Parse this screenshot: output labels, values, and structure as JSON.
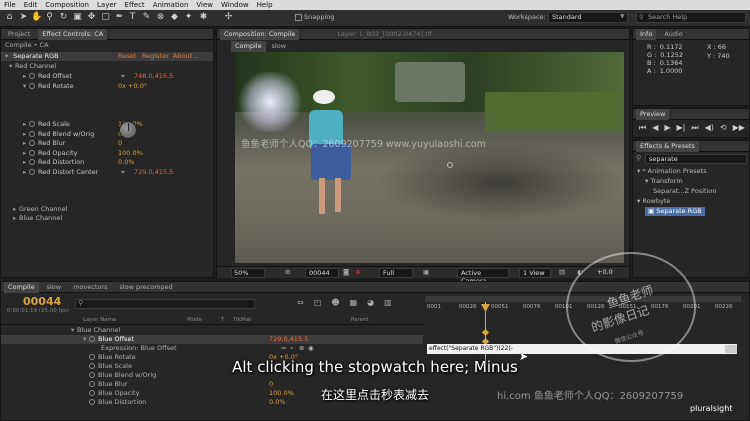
{
  "menu": [
    "File",
    "Edit",
    "Composition",
    "Layer",
    "Effect",
    "Animation",
    "View",
    "Window",
    "Help"
  ],
  "toolbar": {
    "snapping_label": "Snapping",
    "workspace_label": "Workspace:",
    "workspace_value": "Standard",
    "search_placeholder": "Search Help"
  },
  "effect_controls": {
    "tabs": [
      "Project",
      "Effect Controls: CA"
    ],
    "breadcrumb": "Compile • CA",
    "effect_name": "Separate RGB",
    "effect_links": [
      "Reset",
      "Register",
      "About..."
    ],
    "red_channel": "Red Channel",
    "props": [
      {
        "label": "Red Offset",
        "value": "748.0,416.5",
        "depth": 2,
        "kind": "point"
      },
      {
        "label": "Red Rotate",
        "value": "0x +0.0°",
        "depth": 2,
        "kind": "plain"
      },
      {
        "label": "Red Scale",
        "value": "100.0%",
        "depth": 2,
        "kind": "plain"
      },
      {
        "label": "Red Blend w/Orig",
        "value": "0.0%",
        "depth": 2,
        "kind": "plain"
      },
      {
        "label": "Red Blur",
        "value": "0",
        "depth": 2,
        "kind": "plain"
      },
      {
        "label": "Red Opacity",
        "value": "100.0%",
        "depth": 2,
        "kind": "plain"
      },
      {
        "label": "Red Distortion",
        "value": "0.0%",
        "depth": 2,
        "kind": "plain"
      },
      {
        "label": "Red Distort Center",
        "value": "729.0,415.5",
        "depth": 2,
        "kind": "point"
      }
    ],
    "green_channel": "Green Channel",
    "blue_channel": "Blue Channel"
  },
  "composition": {
    "tab": "Composition: Compile",
    "layer_tab": "Layer: L_B02_[0002-0474].tif",
    "breadcrumbs": [
      "Compile",
      "slow"
    ],
    "zoom": "50%",
    "timecode": "00044",
    "resolution": "Full",
    "camera": "Active Camera",
    "view": "1 View",
    "offset": "+0.0"
  },
  "info": {
    "tabs": [
      "Info",
      "Audio"
    ],
    "rows": [
      {
        "k": "R :",
        "v": "0.1172"
      },
      {
        "k": "G :",
        "v": "0.1252"
      },
      {
        "k": "B :",
        "v": "0.1364"
      },
      {
        "k": "A :",
        "v": "1.0000"
      }
    ],
    "x": "X : 66",
    "y": "Y : 740"
  },
  "preview": {
    "tab": "Preview"
  },
  "effects_presets": {
    "tab": "Effects & Presets",
    "search": "separate",
    "items": [
      {
        "label": "* Animation Presets",
        "depth": 0
      },
      {
        "label": "Transform",
        "depth": 1
      },
      {
        "label": "Separat...Z Position",
        "depth": 2
      },
      {
        "label": "Rowbyte",
        "depth": 0
      },
      {
        "label": "Separate RGB",
        "depth": 1
      }
    ]
  },
  "timeline": {
    "tabs": [
      "Compile",
      "slow",
      "movectors",
      "slow precomped"
    ],
    "timecode": "00044",
    "timecode_sub": "0:00:01:19 (25.00 fps)",
    "columns": {
      "layer_name": "Layer Name",
      "mode": "Mode",
      "t": "T",
      "trkmat": "TrkMat",
      "parent": "Parent"
    },
    "ruler": [
      "0001",
      "00026",
      "00051",
      "00076",
      "00101",
      "00126",
      "00151",
      "00176",
      "00201",
      "00226"
    ],
    "rows": [
      {
        "label": "Blue Channel",
        "value": "",
        "depth": 0
      },
      {
        "label": "Blue Offset",
        "value": "729.0,415.5",
        "depth": 1,
        "selected": true
      },
      {
        "label": "Expression: Blue Offset",
        "value": "",
        "depth": 2
      },
      {
        "label": "Blue Rotate",
        "value": "0x +0.0°",
        "depth": 1
      },
      {
        "label": "Blue Scale",
        "value": "",
        "depth": 1
      },
      {
        "label": "Blue Blend w/Orig",
        "value": "",
        "depth": 1
      },
      {
        "label": "Blue Blur",
        "value": "0",
        "depth": 1
      },
      {
        "label": "Blue Opacity",
        "value": "100.0%",
        "depth": 1
      },
      {
        "label": "Blue Distortion",
        "value": "0.0%",
        "depth": 1
      }
    ],
    "expression": "effect(\"Separate RGB\")(22)-"
  },
  "subtitles": {
    "en": "Alt clicking the stopwatch here; Minus",
    "zh": "在这里点击秒表减去"
  },
  "watermarks": {
    "center": "鱼鱼老师个人QQ：2609207759 www.yuyulaoshi.com",
    "bottom": "hi.com  鱼鱼老师个人QQ：2609207759",
    "stamp_line1": "鱼鱼老师",
    "stamp_line2": "的影像日记",
    "stamp_line3": "微信公众号",
    "brand": "pluralsight"
  }
}
